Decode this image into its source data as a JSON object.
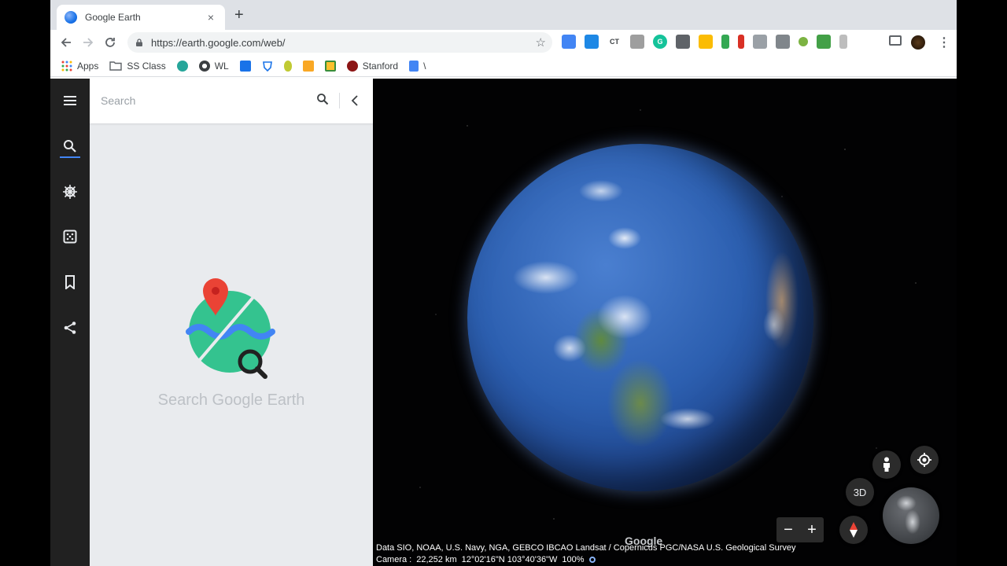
{
  "browser": {
    "tab_title": "Google Earth",
    "tab_close": "×",
    "new_tab": "+",
    "url": "https://earth.google.com/web/",
    "menu_glyph": "⋮",
    "bookmarks": [
      {
        "label": "Apps",
        "icon": "apps-grid-icon"
      },
      {
        "label": "SS Class",
        "icon": "folder-icon"
      },
      {
        "label": "",
        "icon": "s-logo-icon"
      },
      {
        "label": "WL",
        "icon": "globe-icon"
      },
      {
        "label": "",
        "icon": "building-icon"
      },
      {
        "label": "",
        "icon": "shield-icon"
      },
      {
        "label": "",
        "icon": "pear-icon"
      },
      {
        "label": "",
        "icon": "puzzle-icon"
      },
      {
        "label": "",
        "icon": "classroom-icon"
      },
      {
        "label": "Stanford",
        "icon": "stanford-icon"
      },
      {
        "label": "\\",
        "icon": "docs-icon"
      }
    ],
    "extensions": [
      "ext-1",
      "ext-2",
      "CT",
      "ext-4",
      "G",
      "ext-6",
      "ext-7",
      "ext-8",
      "ext-9",
      "ext-10",
      "ext-11",
      "ext-12",
      "ext-13",
      "ext-14"
    ]
  },
  "earth": {
    "search_placeholder": "Search",
    "empty_state": "Search Google Earth",
    "view_mode": "3D",
    "zoom_out": "−",
    "zoom_in": "+",
    "watermark": "Google",
    "attribution": "Data SIO, NOAA, U.S. Navy, NGA, GEBCO IBCAO Landsat / Copernicus PGC/NASA U.S. Geological Survey",
    "camera_label": "Camera :",
    "camera_distance": "22,252 km",
    "coordinates": "12°02'16\"N 103°40'36\"W",
    "load_percent": "100%"
  },
  "colors": {
    "accent": "#4285f4",
    "rail": "#212121",
    "panel": "#e9ebee",
    "pin": "#ea4335",
    "globe_green": "#34c38f"
  }
}
